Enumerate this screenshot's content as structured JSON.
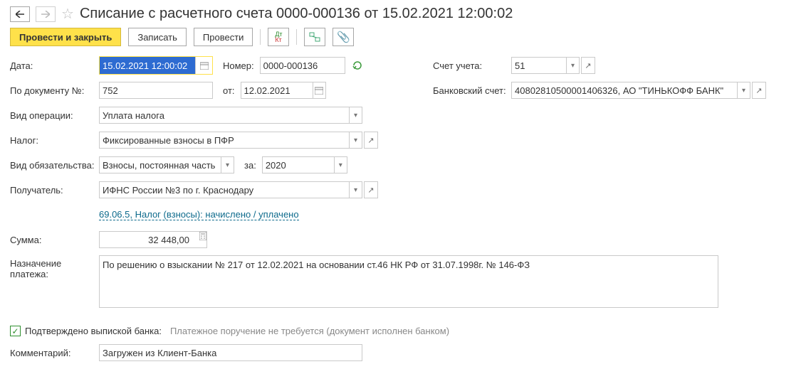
{
  "header": {
    "title": "Списание с расчетного счета 0000-000136 от 15.02.2021 12:00:02"
  },
  "toolbar": {
    "post_close": "Провести и закрыть",
    "save": "Записать",
    "post": "Провести"
  },
  "labels": {
    "date": "Дата:",
    "number": "Номер:",
    "account": "Счет учета:",
    "doc_no": "По документу №:",
    "from": "от:",
    "bank_account": "Банковский счет:",
    "op_type": "Вид операции:",
    "tax": "Налог:",
    "obligation": "Вид обязательства:",
    "for": "за:",
    "recipient": "Получатель:",
    "amount": "Сумма:",
    "purpose": "Назначение платежа:",
    "confirmed": "Подтверждено выпиской банка:",
    "order_note": "Платежное поручение не требуется (документ исполнен банком)",
    "comment": "Комментарий:"
  },
  "fields": {
    "date": "15.02.2021 12:00:02",
    "number": "0000-000136",
    "account": "51",
    "doc_no": "752",
    "doc_date": "12.02.2021",
    "bank_account": "40802810500001406326, АО \"ТИНЬКОФФ БАНК\"",
    "op_type": "Уплата налога",
    "tax": "Фиксированные взносы в ПФР",
    "obligation": "Взносы, постоянная часть",
    "for_year": "2020",
    "recipient": "ИФНС России №3 по г. Краснодару",
    "kbk_link": "69.06.5, Налог (взносы): начислено / уплачено",
    "amount": "32 448,00",
    "purpose": "По решению о взыскании № 217 от 12.02.2021 на основании ст.46 НК РФ от 31.07.1998г. № 146-ФЗ",
    "comment": "Загружен из Клиент-Банка"
  }
}
